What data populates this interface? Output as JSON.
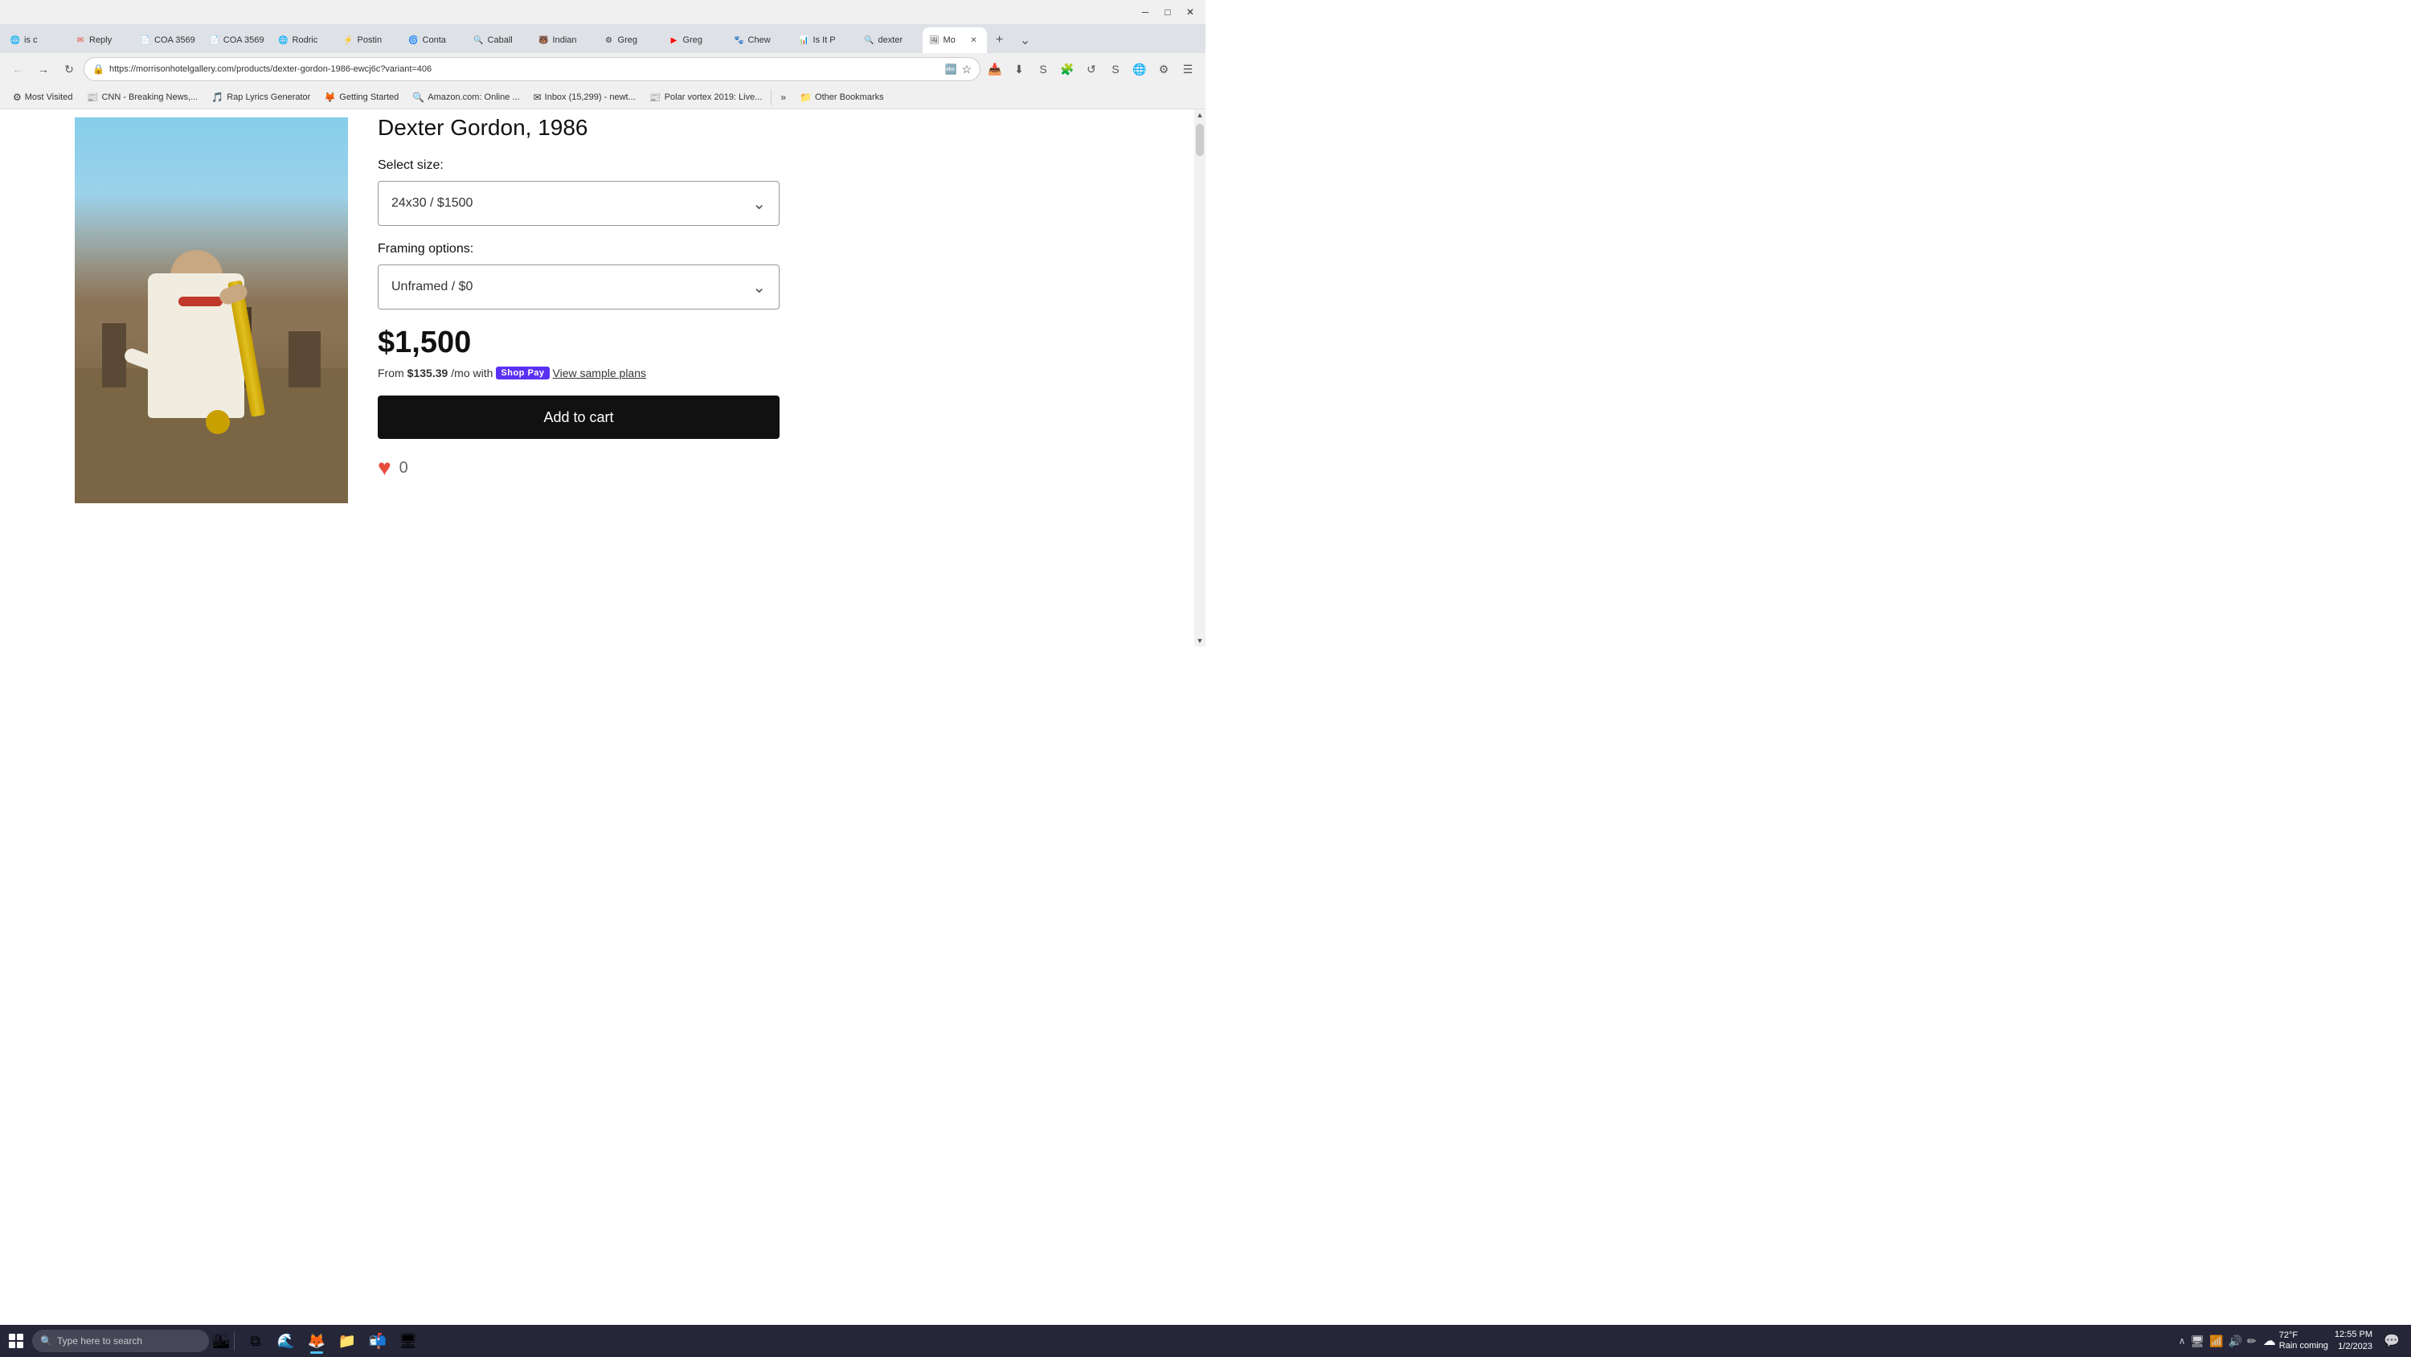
{
  "browser": {
    "titlebar": {
      "minimize_label": "─",
      "maximize_label": "□",
      "close_label": "✕"
    },
    "tabs": [
      {
        "id": "tab-prev",
        "favicon": "🌐",
        "title": "is c",
        "active": false
      },
      {
        "id": "tab-gmail",
        "favicon": "✉",
        "title": "Reply",
        "active": false,
        "color": "#EA4335"
      },
      {
        "id": "tab-coa1",
        "favicon": "📄",
        "title": "COA 3569",
        "active": false
      },
      {
        "id": "tab-coa2",
        "favicon": "📄",
        "title": "COA 3569",
        "active": false
      },
      {
        "id": "tab-rod",
        "favicon": "🌐",
        "title": "Rodric",
        "active": false
      },
      {
        "id": "tab-post",
        "favicon": "⚡",
        "title": "Postin",
        "active": false,
        "color": "#a855f7"
      },
      {
        "id": "tab-cont",
        "favicon": "🌀",
        "title": "Conta",
        "active": false,
        "color": "#6366f1"
      },
      {
        "id": "tab-caball",
        "favicon": "🔍",
        "title": "Caball",
        "active": false
      },
      {
        "id": "tab-indian",
        "favicon": "🐻",
        "title": "Indian",
        "active": false
      },
      {
        "id": "tab-greg1",
        "favicon": "⚙",
        "title": "Greg",
        "active": false,
        "color": "#e0352b"
      },
      {
        "id": "tab-greg2",
        "favicon": "▶",
        "title": "Greg",
        "active": false,
        "color": "#FF0000"
      },
      {
        "id": "tab-chew",
        "favicon": "🐾",
        "title": "Chew",
        "active": false,
        "color": "#e94057"
      },
      {
        "id": "tab-isit",
        "favicon": "📊",
        "title": "Is It P",
        "active": false
      },
      {
        "id": "tab-dext",
        "favicon": "🔍",
        "title": "dexter",
        "active": false
      },
      {
        "id": "tab-mo",
        "favicon": "🖼",
        "title": "Mo",
        "active": true,
        "color": "#cc1a1a"
      }
    ],
    "new_tab_label": "+",
    "address": "https://morrisonhotelgallery.com/products/dexter-gordon-1986-ewcj6c?variant=406",
    "bookmarks": [
      {
        "icon": "⚙",
        "label": "Most Visited"
      },
      {
        "icon": "📰",
        "label": "CNN - Breaking News,..."
      },
      {
        "icon": "🎵",
        "label": "Rap Lyrics Generator"
      },
      {
        "icon": "🦊",
        "label": "Getting Started"
      },
      {
        "icon": "🔍",
        "label": "Amazon.com: Online ..."
      },
      {
        "icon": "✉",
        "label": "Inbox (15,299) - newt..."
      },
      {
        "icon": "📰",
        "label": "Polar vortex 2019: Live..."
      },
      {
        "icon": "»",
        "label": "»"
      },
      {
        "icon": "📁",
        "label": "Other Bookmarks"
      }
    ]
  },
  "product": {
    "title": "Dexter Gordon, 1986",
    "select_size_label": "Select size:",
    "size_option": "24x30 / $1500",
    "framing_label": "Framing options:",
    "framing_option": "Unframed / $0",
    "price": "$1,500",
    "shopPay": {
      "prefix": "From",
      "amount": "$135.39",
      "suffix": "/mo with",
      "badge": "Shop Pay",
      "link": "View sample plans"
    },
    "add_to_cart": "Add to cart",
    "wishlist_count": "0"
  },
  "taskbar": {
    "search_placeholder": "Type here to search",
    "apps": [
      {
        "id": "windows-btn",
        "icon": "⊞",
        "label": "Windows"
      },
      {
        "id": "task-view",
        "icon": "❑",
        "label": "Task View"
      },
      {
        "id": "edge",
        "icon": "🌊",
        "label": "Microsoft Edge"
      },
      {
        "id": "firefox",
        "icon": "🦊",
        "label": "Firefox"
      },
      {
        "id": "files",
        "icon": "📁",
        "label": "File Explorer"
      },
      {
        "id": "outlook",
        "icon": "📬",
        "label": "Outlook"
      },
      {
        "id": "app7",
        "icon": "🖥",
        "label": "App"
      }
    ],
    "weather": {
      "icon": "☁",
      "temp": "72°F",
      "desc": "Rain coming"
    },
    "time": "12:55 PM",
    "date": "1/2/2023"
  }
}
